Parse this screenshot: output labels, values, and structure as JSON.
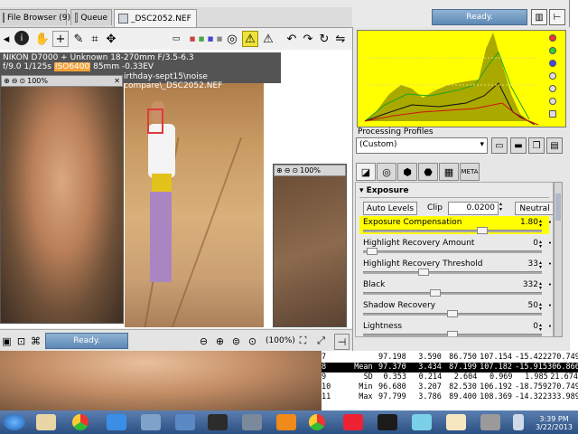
{
  "tabs": [
    {
      "label": "File Browser (9)"
    },
    {
      "label": "Queue"
    },
    {
      "label": "_DSC2052.NEF"
    }
  ],
  "status": {
    "ready_top": "Ready.",
    "ready_bottom": "Ready."
  },
  "exif": {
    "line1": "NIKON D7000 + Unknown 18-270mm F/3.5-6.3",
    "line2_a": "f/9.0  1/125s  ",
    "iso": "ISO6400",
    "line2_b": "  85mm  -0.33EV",
    "path": "irthday-sept15\\noise compare\\_DSC2052.NEF"
  },
  "detail": {
    "zoom1": "100%",
    "zoom2": "100%"
  },
  "zoom": {
    "level": "(100%)"
  },
  "profiles": {
    "label": "Processing Profiles",
    "selected": "(Custom)"
  },
  "exposure": {
    "title": "Exposure",
    "auto_levels": "Auto Levels",
    "clip_label": "Clip",
    "clip_value": "0.0200",
    "neutral": "Neutral",
    "rows": [
      {
        "label": "Exposure Compensation",
        "value": "1.80",
        "level": 0.68
      },
      {
        "label": "Highlight Recovery Amount",
        "value": "0",
        "level": 0.02
      },
      {
        "label": "Highlight Recovery Threshold",
        "value": "33",
        "level": 0.33
      },
      {
        "label": "Black",
        "value": "332",
        "level": 0.4
      },
      {
        "label": "Shadow Recovery",
        "value": "50",
        "level": 0.5
      },
      {
        "label": "Lightness",
        "value": "0",
        "level": 0.5
      }
    ]
  },
  "sheet": {
    "rows": [
      [
        "7",
        "97.198",
        "3.590",
        "86.750",
        "107.154",
        "-15.422",
        "270.749"
      ],
      [
        "8",
        "Mean",
        "97.370",
        "3.434",
        "87.199",
        "107.182",
        "-15.915",
        "306.866"
      ],
      [
        "9",
        "SD",
        "0.353",
        "0.214",
        "2.604",
        "0.969",
        "1.985",
        "21.674"
      ],
      [
        "10",
        "Min",
        "96.680",
        "3.207",
        "82.530",
        "106.192",
        "-18.759",
        "270.749"
      ],
      [
        "11",
        "Max",
        "97.799",
        "3.786",
        "89.400",
        "108.369",
        "-14.322",
        "333.989"
      ]
    ]
  },
  "clock": {
    "time": "3:39 PM",
    "date": "3/22/2013"
  },
  "colors": {
    "histogram_bg": "#ffff00",
    "highlight": "#ffff00",
    "ready": "#6f98c2"
  }
}
